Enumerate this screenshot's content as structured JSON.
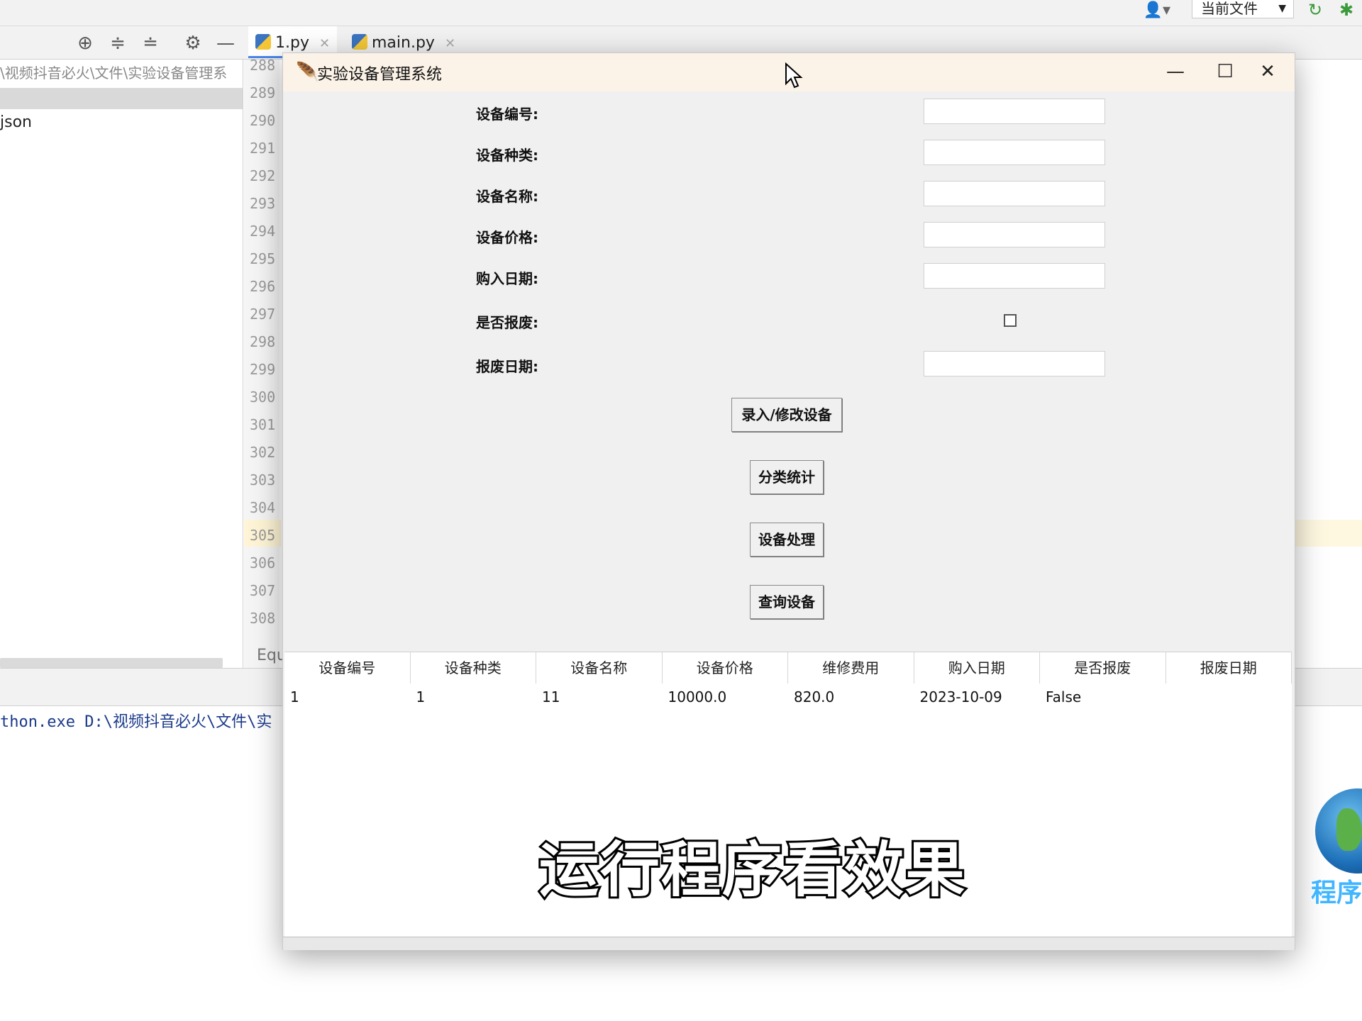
{
  "ide": {
    "scope_select": "当前文件",
    "tabs": [
      {
        "label": "1.py",
        "active": true
      },
      {
        "label": "main.py",
        "active": false
      }
    ],
    "project_path": "\\视频抖音必火\\文件\\实验设备管理系",
    "project_item": "json",
    "line_numbers": [
      "288",
      "289",
      "290",
      "291",
      "292",
      "293",
      "294",
      "295",
      "296",
      "297",
      "298",
      "299",
      "300",
      "301",
      "302",
      "303",
      "304",
      "305",
      "306",
      "307",
      "308"
    ],
    "highlight_line": "305",
    "equ_label": "Equ",
    "console_line": "thon.exe D:\\视频抖音必火\\文件\\实"
  },
  "window": {
    "title": "实验设备管理系统",
    "controls": {
      "minimize": "—",
      "maximize": "☐",
      "close": "✕"
    },
    "fields": [
      {
        "label": "设备编号:",
        "value": ""
      },
      {
        "label": "设备种类:",
        "value": ""
      },
      {
        "label": "设备名称:",
        "value": ""
      },
      {
        "label": "设备价格:",
        "value": ""
      },
      {
        "label": "购入日期:",
        "value": ""
      },
      {
        "label": "是否报废:",
        "checked": false
      },
      {
        "label": "报废日期:",
        "value": ""
      }
    ],
    "buttons": {
      "add_edit": "录入/修改设备",
      "stats": "分类统计",
      "process": "设备处理",
      "query": "查询设备"
    },
    "table": {
      "columns": [
        "设备编号",
        "设备种类",
        "设备名称",
        "设备价格",
        "维修费用",
        "购入日期",
        "是否报废",
        "报废日期"
      ],
      "rows": [
        [
          "1",
          "1",
          "11",
          "10000.0",
          "820.0",
          "2023-10-09",
          "False",
          ""
        ]
      ]
    }
  },
  "overlay": {
    "subtitle": "运行程序看效果",
    "watermark": "程序猿"
  },
  "icons": {
    "toolbar": [
      "crosshair-icon",
      "expand-all-icon",
      "collapse-all-icon",
      "gear-icon",
      "minimize-panel-icon"
    ],
    "accent": "#4a86e8"
  }
}
